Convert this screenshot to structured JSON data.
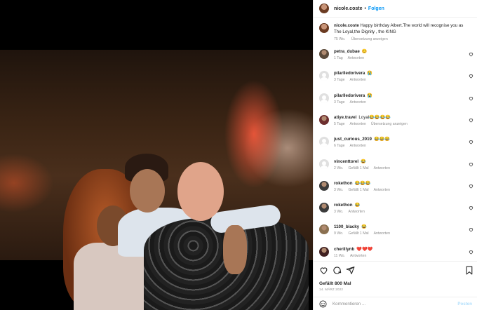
{
  "post": {
    "username": "nicole.coste",
    "separator": "•",
    "follow_label": "Folgen",
    "caption": "Happy birthday Albert.The world will recognise you as The Loyal,the Dignity , the KING",
    "caption_age": "75 Wo.",
    "caption_translate": "Übersetzung anzeigen",
    "likes": "Gefällt 800 Mal",
    "date": "14. MÄRZ 2022",
    "add_comment_placeholder": "Kommentieren ...",
    "post_label": "Posten"
  },
  "comments": [
    {
      "user": "petra_dubae",
      "text": "😊",
      "age": "1 Tag",
      "reply": "Antworten",
      "likes": "",
      "translate": ""
    },
    {
      "user": "pilarlledorivera",
      "text": "😭",
      "age": "3 Tage",
      "reply": "Antworten",
      "likes": "",
      "translate": ""
    },
    {
      "user": "pilarlledorivera",
      "text": "😭",
      "age": "3 Tage",
      "reply": "Antworten",
      "likes": "",
      "translate": ""
    },
    {
      "user": "atiye.travel",
      "text": "Loyal😂😂😂😂",
      "age": "5 Tage",
      "reply": "Antworten",
      "likes": "",
      "translate": "Übersetzung anzeigen"
    },
    {
      "user": "just_curious_2019",
      "text": "😂😂😂",
      "age": "6 Tage",
      "reply": "Antworten",
      "likes": "",
      "translate": ""
    },
    {
      "user": "vincenttorel",
      "text": "😂",
      "age": "2 Wo.",
      "reply": "Antworten",
      "likes": "Gefällt 1 Mal",
      "translate": ""
    },
    {
      "user": "rokethon",
      "text": "😂😂😂",
      "age": "3 Wo.",
      "reply": "Antworten",
      "likes": "Gefällt 1 Mal",
      "translate": ""
    },
    {
      "user": "rokethon",
      "text": "😂",
      "age": "3 Wo.",
      "reply": "Antworten",
      "likes": "",
      "translate": ""
    },
    {
      "user": "1100_blacky",
      "text": "😂",
      "age": "9 Wo.",
      "reply": "Antworten",
      "likes": "Gefällt 1 Mal",
      "translate": ""
    },
    {
      "user": "cherillynb",
      "text": "❤️❤️❤️",
      "age": "11 Wo.",
      "reply": "Antworten",
      "likes": "",
      "translate": ""
    }
  ],
  "icons": {
    "like": "heart-icon",
    "comment": "comment-icon",
    "share": "share-icon",
    "save": "bookmark-icon",
    "emoji": "smiley-icon"
  },
  "colors": {
    "accent": "#0095f6",
    "text": "#262626",
    "muted": "#8e8e8e"
  }
}
